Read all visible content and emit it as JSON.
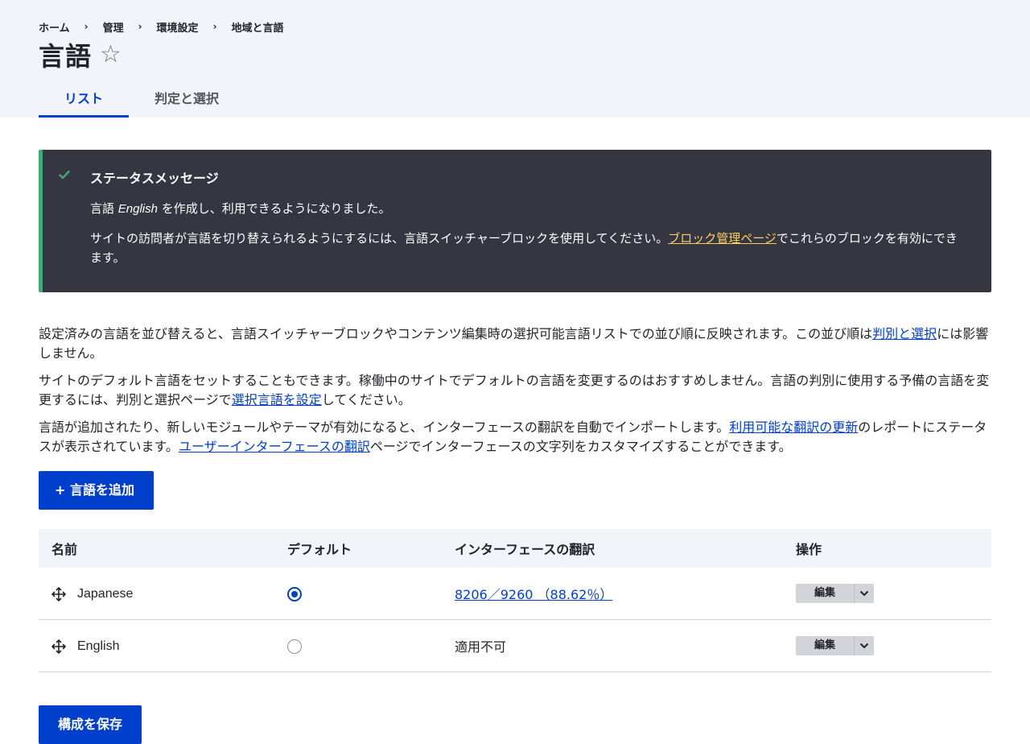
{
  "breadcrumb": [
    "ホーム",
    "管理",
    "環境設定",
    "地域と言語"
  ],
  "page": {
    "title": "言語",
    "favorite_icon": "star-outline-icon"
  },
  "tabs": [
    "リスト",
    "判定と選択"
  ],
  "status": {
    "title": "ステータスメッセージ",
    "line1_pre": "言語 ",
    "line1_lang": "English",
    "line1_post": " を作成し、利用できるようになりました。",
    "line2_pre": "サイトの訪問者が言語を切り替えられるようにするには、言語スイッチャーブロックを使用してください。",
    "line2_link": "ブロック管理ページ",
    "line2_post": "でこれらのブロックを有効にできます。"
  },
  "description": {
    "p1_pre": "設定済みの言語を並び替えると、言語スイッチャーブロックやコンテンツ編集時の選択可能言語リストでの並び順に反映されます。この並び順は",
    "p1_link": "判別と選択",
    "p1_post": "には影響しません。",
    "p2_pre": "サイトのデフォルト言語をセットすることもできます。稼働中のサイトでデフォルトの言語を変更するのはおすすめしません。言語の判別に使用する予備の言語を変更するには、判別と選択ページで",
    "p2_link": "選択言語を設定",
    "p2_post": "してください。",
    "p3_pre": "言語が追加されたり、新しいモジュールやテーマが有効になると、インターフェースの翻訳を自動でインポートします。",
    "p3_link1": "利用可能な翻訳の更新",
    "p3_mid": "のレポートにステータスが表示されています。",
    "p3_link2": "ユーザーインターフェースの翻訳",
    "p3_post": "ページでインターフェースの文字列をカスタマイズすることができます。"
  },
  "add_button": "+ 言語を追加",
  "table": {
    "headers": [
      "名前",
      "デフォルト",
      "インターフェースの翻訳",
      "操作"
    ],
    "rows": [
      {
        "name": "Japanese",
        "default": true,
        "translation": "8206／9260 （88.62％）",
        "edit": "編集"
      },
      {
        "name": "English",
        "default": false,
        "translation": "適用不可",
        "edit": "編集"
      }
    ]
  },
  "save_button": "構成を保存",
  "colors": {
    "primary": "#003ecc",
    "status_bg": "#353641",
    "status_accent": "#42a877",
    "status_link": "#fcce5b"
  }
}
